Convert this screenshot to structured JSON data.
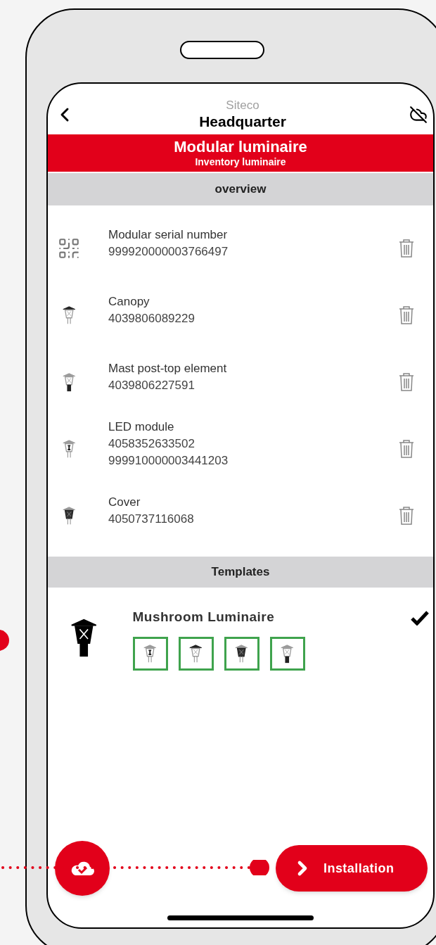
{
  "header": {
    "supertitle": "Siteco",
    "title": "Headquarter"
  },
  "banner": {
    "title": "Modular luminaire",
    "subtitle": "Inventory luminaire"
  },
  "overview": {
    "heading": "overview",
    "items": [
      {
        "kind": "qr",
        "label": "Modular serial number",
        "values": [
          "999920000003766497"
        ]
      },
      {
        "kind": "canopy",
        "label": "Canopy",
        "values": [
          "4039806089229"
        ]
      },
      {
        "kind": "mast",
        "label": "Mast post-top element",
        "values": [
          "4039806227591"
        ]
      },
      {
        "kind": "led",
        "label": "LED module",
        "values": [
          "4058352633502",
          "999910000003441203"
        ]
      },
      {
        "kind": "cover",
        "label": "Cover",
        "values": [
          "4050737116068"
        ]
      }
    ]
  },
  "templates": {
    "heading": "Templates",
    "items": [
      {
        "name": "Mushroom Luminaire",
        "selected": true,
        "parts": [
          {
            "kind": "led"
          },
          {
            "kind": "canopy"
          },
          {
            "kind": "cover"
          },
          {
            "kind": "mast"
          }
        ]
      }
    ]
  },
  "actions": {
    "next_button": {
      "label": "Installation"
    }
  }
}
